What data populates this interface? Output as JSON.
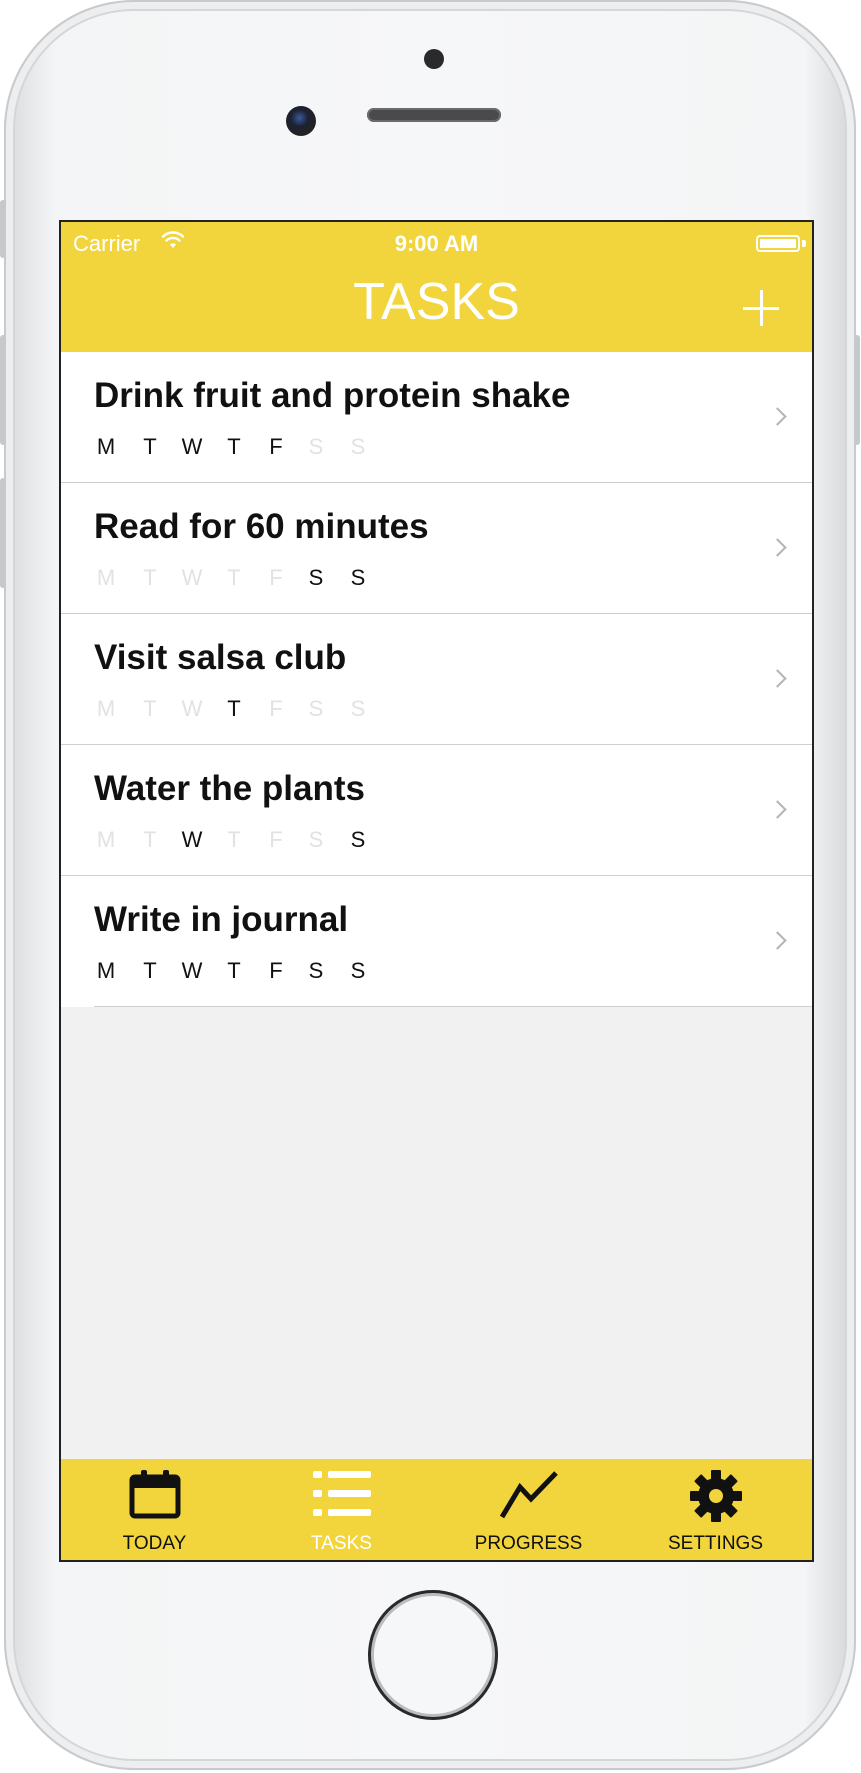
{
  "status_bar": {
    "carrier": "Carrier",
    "time": "9:00 AM"
  },
  "nav": {
    "title": "TASKS",
    "add_icon": "plus-icon"
  },
  "tasks": [
    {
      "title": "Drink fruit and protein shake",
      "days": [
        true,
        true,
        true,
        true,
        true,
        false,
        false
      ]
    },
    {
      "title": "Read for 60 minutes",
      "days": [
        false,
        false,
        false,
        false,
        false,
        true,
        true
      ]
    },
    {
      "title": "Visit salsa club",
      "days": [
        false,
        false,
        false,
        true,
        false,
        false,
        false
      ]
    },
    {
      "title": "Water the plants",
      "days": [
        false,
        false,
        true,
        false,
        false,
        false,
        true
      ]
    },
    {
      "title": "Write in journal",
      "days": [
        true,
        true,
        true,
        true,
        true,
        true,
        true
      ]
    }
  ],
  "day_letters": [
    "M",
    "T",
    "W",
    "T",
    "F",
    "S",
    "S"
  ],
  "tabs": [
    {
      "label": "TODAY",
      "icon": "calendar-icon",
      "active": false
    },
    {
      "label": "TASKS",
      "icon": "list-icon",
      "active": true
    },
    {
      "label": "PROGRESS",
      "icon": "trend-line-icon",
      "active": false
    },
    {
      "label": "SETTINGS",
      "icon": "gear-icon",
      "active": false
    }
  ],
  "colors": {
    "accent": "#f2d53c",
    "day_on": "#111111",
    "day_off": "#e2e2e4"
  }
}
